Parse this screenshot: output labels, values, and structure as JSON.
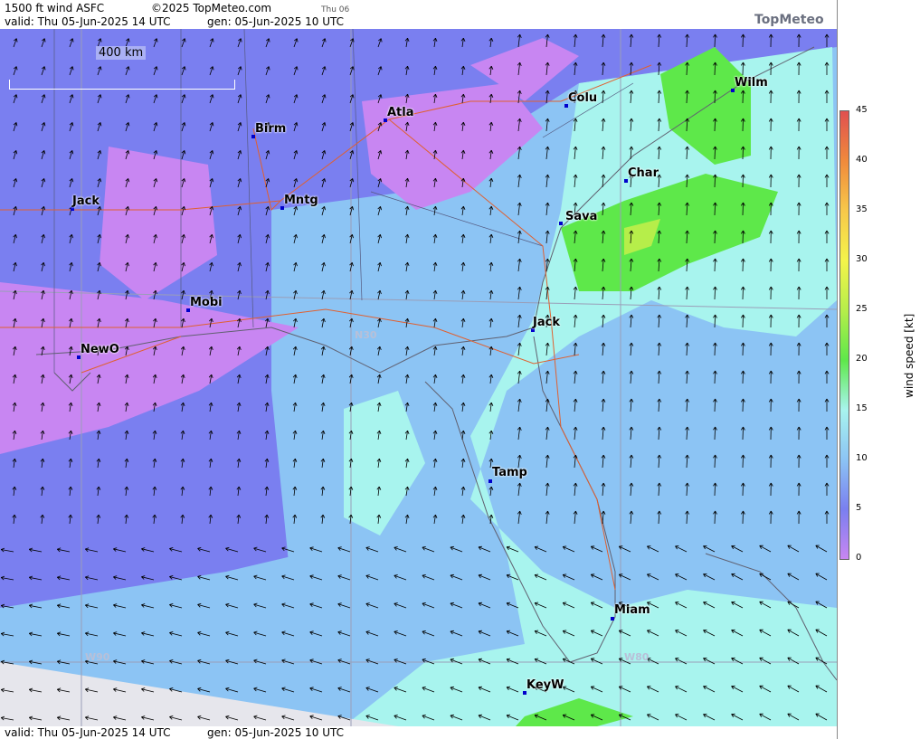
{
  "header": {
    "product": "1500 ft wind ASFC",
    "copyright": "©2025 TopMeteo.com",
    "day_small": "Thu 06",
    "valid": "valid:  Thu  05-Jun-2025  14 UTC",
    "gen": "gen: 05-Jun-2025 10 UTC",
    "logo": "TopMeteo"
  },
  "footer": {
    "valid": "valid:  Thu  05-Jun-2025  14 UTC",
    "gen": "gen: 05-Jun-2025 10 UTC"
  },
  "scale": {
    "label": "400 km"
  },
  "grid_labels": {
    "n30": "N30",
    "w90": "W90",
    "w80": "W80"
  },
  "cities": [
    {
      "name": "Birm"
    },
    {
      "name": "Atla"
    },
    {
      "name": "Colu"
    },
    {
      "name": "Wilm"
    },
    {
      "name": "Jack"
    },
    {
      "name": "Mntg"
    },
    {
      "name": "Char"
    },
    {
      "name": "Sava"
    },
    {
      "name": "Mobi"
    },
    {
      "name": "Jack"
    },
    {
      "name": "NewO"
    },
    {
      "name": "Tamp"
    },
    {
      "name": "Miam"
    },
    {
      "name": "KeyW"
    }
  ],
  "legend": {
    "title": "wind speed [kt]",
    "ticks": [
      "45",
      "40",
      "35",
      "30",
      "25",
      "20",
      "15",
      "10",
      "5",
      "0"
    ],
    "colors": [
      "#e05050",
      "#f08a3c",
      "#f7c84a",
      "#f4f44a",
      "#b6ee4a",
      "#5ee84a",
      "#a8f4ee",
      "#8cc4f4",
      "#7a7ff0",
      "#c886f2"
    ]
  }
}
